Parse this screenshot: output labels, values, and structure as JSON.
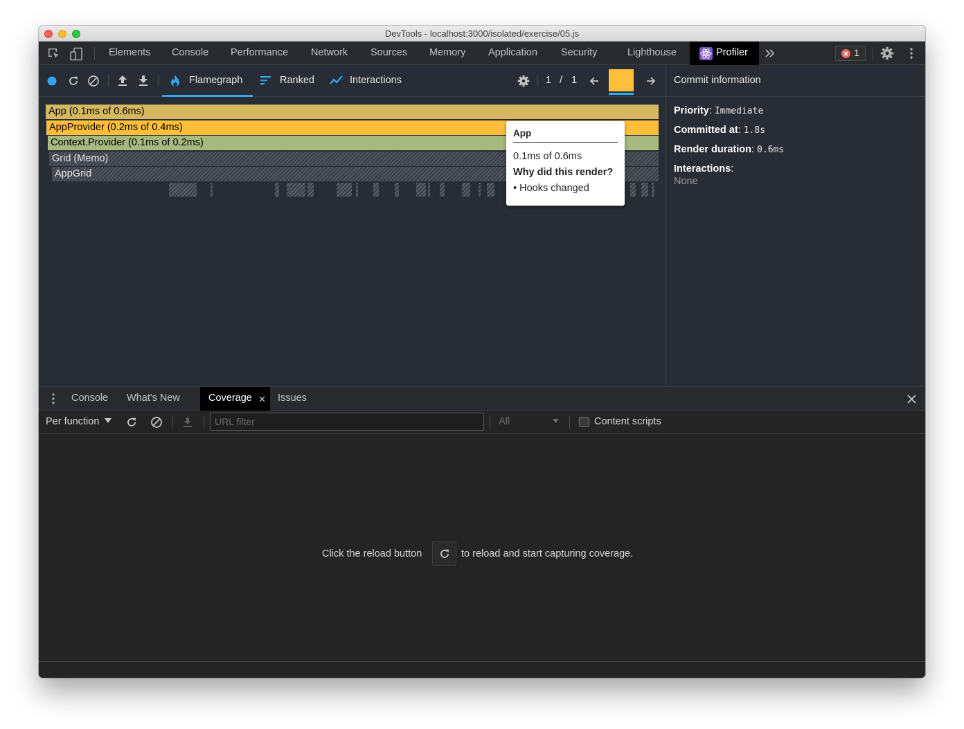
{
  "window_title": "DevTools - localhost:3000/isolated/exercise/05.js",
  "main_tabs": [
    "Elements",
    "Console",
    "Performance",
    "Network",
    "Sources",
    "Memory",
    "Application",
    "Security",
    "Lighthouse"
  ],
  "active_tab": "Profiler",
  "error_count": "1",
  "profiler": {
    "tabs": {
      "flamegraph": "Flamegraph",
      "ranked": "Ranked",
      "interactions": "Interactions"
    },
    "commit_index": "1",
    "commit_sep": "/",
    "commit_total": "1",
    "accent": "#ffbf3a"
  },
  "flame_bars": [
    {
      "label": "App (0.1ms of 0.6ms)",
      "color": "#d6b860"
    },
    {
      "label": "AppProvider (0.2ms of 0.4ms)",
      "color": "#ffbf3a"
    },
    {
      "label": "Context.Provider (0.1ms of 0.2ms)",
      "color": "#a8b87e"
    },
    {
      "label": "Grid (Memo)",
      "color": "hatched"
    },
    {
      "label": "AppGrid",
      "color": "hatched"
    }
  ],
  "tooltip": {
    "title": "App",
    "duration": "0.1ms of 0.6ms",
    "why": "Why did this render?",
    "reason": "• Hooks changed"
  },
  "commit_info": {
    "header": "Commit information",
    "priority_label": "Priority",
    "priority": "Immediate",
    "committed_label": "Committed at",
    "committed": "1.8s",
    "duration_label": "Render duration",
    "duration": "0.6ms",
    "interactions_label": "Interactions",
    "interactions": "None"
  },
  "drawer": {
    "tabs": [
      "Console",
      "What's New",
      "Coverage",
      "Issues"
    ],
    "active": "Coverage"
  },
  "coverage": {
    "mode": "Per function",
    "url_placeholder": "URL filter",
    "type_filter": "All",
    "content_scripts": "Content scripts",
    "message_before": "Click the reload button",
    "message_after": "to reload and start capturing coverage."
  }
}
